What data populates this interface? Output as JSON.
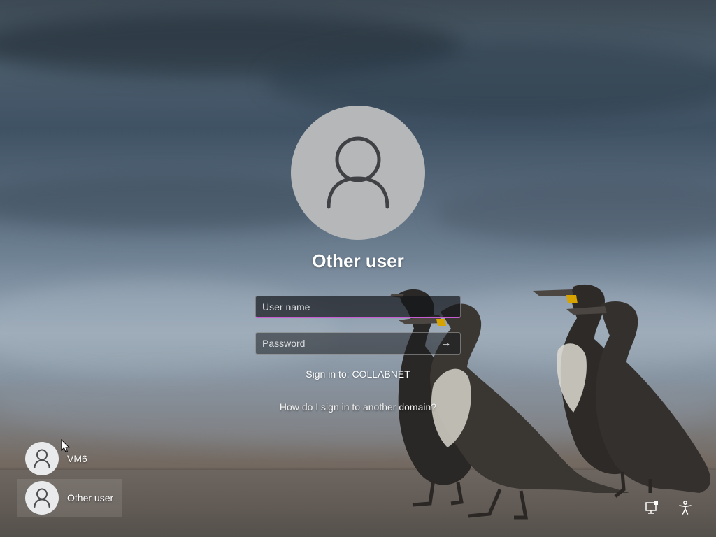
{
  "login": {
    "title": "Other user",
    "username_placeholder": "User name",
    "password_placeholder": "Password",
    "submit_icon": "arrow-right-icon",
    "sign_in_to": "Sign in to: COLLABNET",
    "domain_help_link": "How do I sign in to another domain?"
  },
  "user_list": {
    "items": [
      {
        "label": "VM6",
        "icon": "user-icon"
      },
      {
        "label": "Other user",
        "icon": "user-icon",
        "selected": true
      }
    ]
  },
  "system_icons": [
    {
      "name": "network-icon"
    },
    {
      "name": "accessibility-icon"
    }
  ],
  "colors": {
    "input_focus_underline": "#c75bd1",
    "avatar_background": "#b5b7b9",
    "text": "#ffffff"
  }
}
